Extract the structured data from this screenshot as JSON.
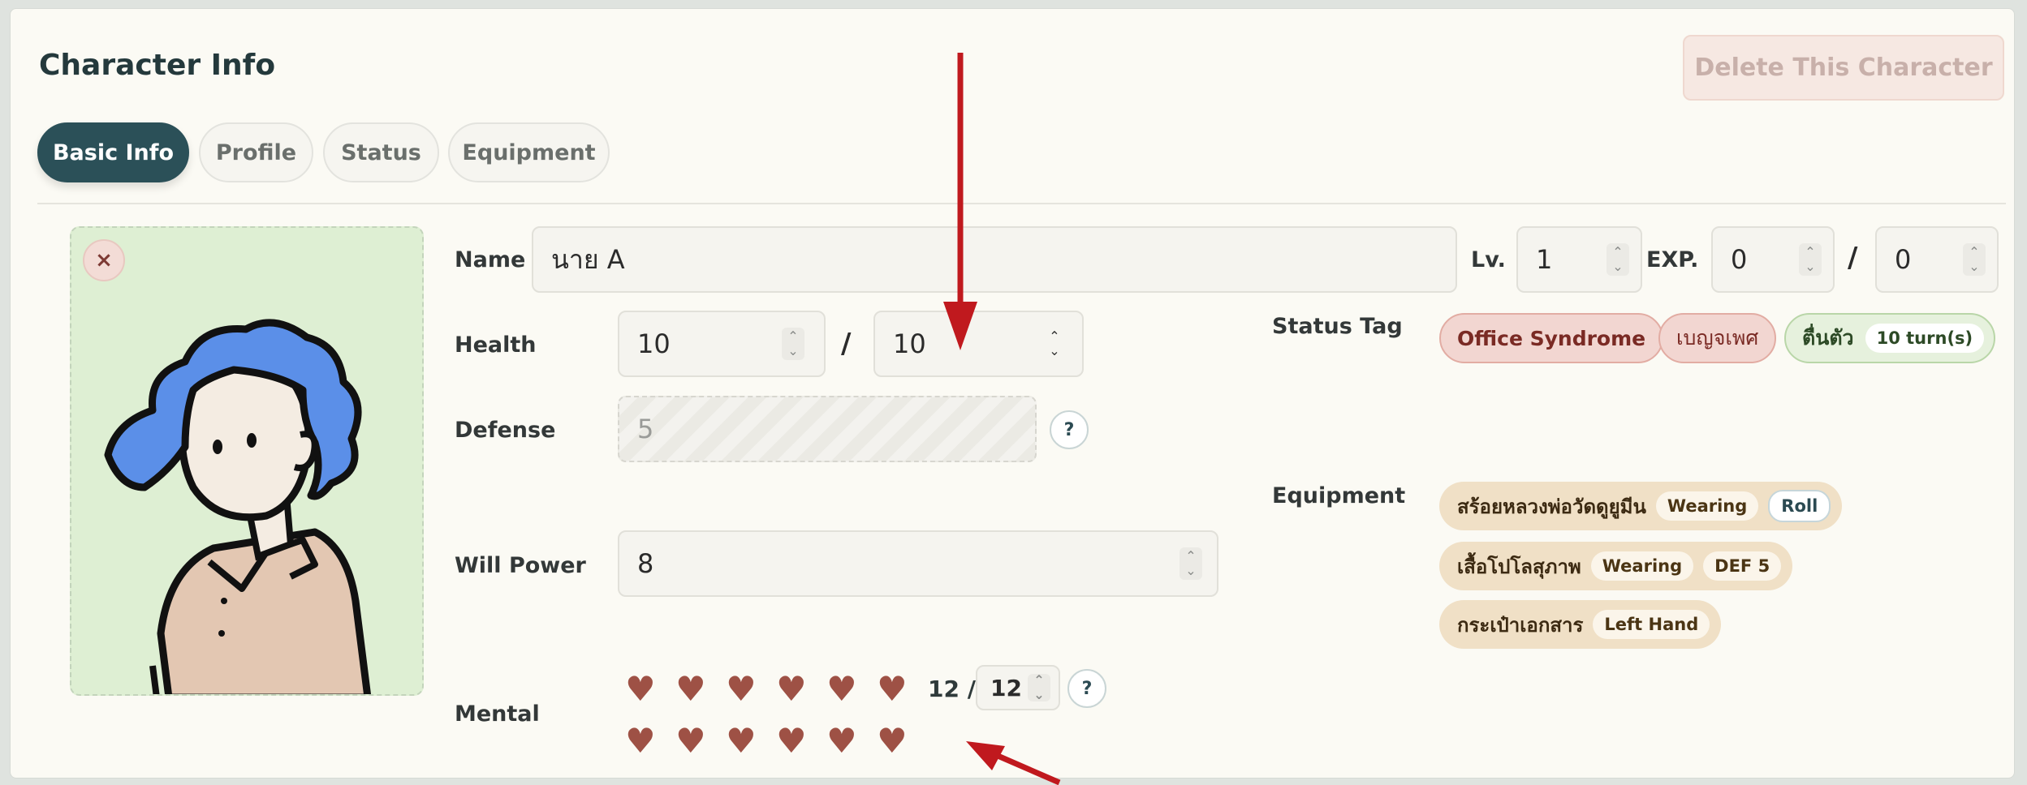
{
  "title": "Character Info",
  "delete_button": "Delete This Character",
  "tabs": [
    {
      "label": "Basic Info",
      "active": true
    },
    {
      "label": "Profile",
      "active": false
    },
    {
      "label": "Status",
      "active": false
    },
    {
      "label": "Equipment",
      "active": false
    }
  ],
  "avatar": {
    "close_symbol": "×"
  },
  "form": {
    "name_label": "Name",
    "name_value": "นาย A",
    "lv_label": "Lv.",
    "lv_value": "1",
    "exp_label": "EXP.",
    "exp_value": "0",
    "exp_max": "0",
    "health_label": "Health",
    "health_value": "10",
    "health_max": "10",
    "defense_label": "Defense",
    "defense_value": "5",
    "willpower_label": "Will Power",
    "willpower_value": "8",
    "mental_label": "Mental",
    "mental_current": "12",
    "mental_max": "12",
    "slash": "/",
    "help_symbol": "?"
  },
  "status_tag": {
    "label": "Status Tag",
    "tags": [
      {
        "text": "Office Syndrome"
      },
      {
        "text": "เบญจเพศ"
      },
      {
        "text": "ตื่นตัว",
        "sub": "10 turn(s)"
      }
    ]
  },
  "equipment": {
    "label": "Equipment",
    "items": [
      {
        "name": "สร้อยหลวงพ่อวัดดูยูมีน",
        "tag": "Wearing",
        "extra": "Roll"
      },
      {
        "name": "เสื้อโปโลสุภาพ",
        "tag": "Wearing",
        "extra": "DEF 5"
      },
      {
        "name": "กระเป๋าเอกสาร",
        "tag": "Left Hand"
      }
    ]
  },
  "colors": {
    "accent": "#2b5058",
    "heart": "#9e5145",
    "annotation_arrow": "#c0191e"
  },
  "icons": [
    "close-icon",
    "spinner-icon",
    "help-icon",
    "heart-icon",
    "annotation-arrow"
  ]
}
